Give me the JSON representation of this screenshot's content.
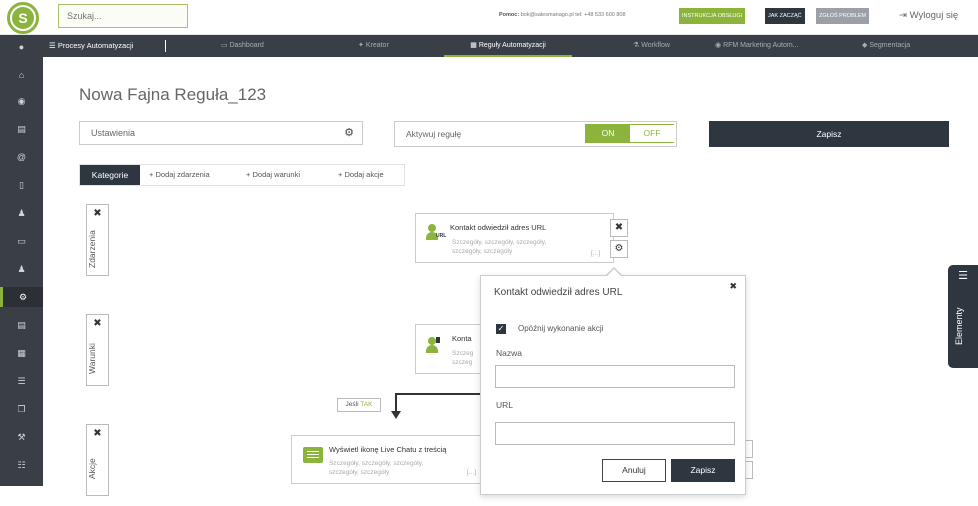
{
  "topbar": {
    "logo_letter": "S",
    "search_placeholder": "Szukaj...",
    "help_label": "Pomoc:",
    "help_contact": "bok@salesmanago.pl tel: +48 533 600 808",
    "btn_instrukcja": "INSTRUKCJA OBSŁUGI",
    "btn_jak_zaczac": "JAK ZACZĄĆ",
    "btn_zglos": "ZGŁOŚ PROBLEM",
    "logout": "Wyloguj się",
    "colors": {
      "instrukcja": "#8cb43c",
      "jak_zaczac": "#2e3640",
      "zglos": "#9aa0a6"
    }
  },
  "navbar": {
    "main": "Procesy Automatyzacji",
    "items": [
      {
        "label": "Dashboard",
        "icon": "monitor-icon"
      },
      {
        "label": "Kreator",
        "icon": "wand-icon"
      },
      {
        "label": "Reguły Automatyzacji",
        "icon": "grid-icon",
        "active": true
      },
      {
        "label": "Workflow",
        "icon": "sitemap-icon"
      },
      {
        "label": "RFM Marketing Autom...",
        "icon": "rfm-icon"
      },
      {
        "label": "Segmentacja",
        "icon": "tag-icon"
      }
    ]
  },
  "sidebar": {
    "icons": [
      "user-circle-icon",
      "home-icon",
      "eye-icon",
      "contact-card-icon",
      "at-icon",
      "mobile-icon",
      "add-user-icon",
      "laptop-icon",
      "users-icon",
      "cogs-icon",
      "chart-icon",
      "calendar-icon",
      "database-icon",
      "copy-icon",
      "wrench-icon",
      "sliders-icon"
    ],
    "active_index": 9
  },
  "page": {
    "title": "Nowa Fajna Reguła_123",
    "settings_label": "Ustawienia",
    "activate_label": "Aktywuj regułę",
    "toggle_on": "ON",
    "toggle_off": "OFF",
    "save_label": "Zapisz"
  },
  "tabs": {
    "kategorie": "Kategorie",
    "dodaj_zdarzenia": "Dodaj zdarzenia",
    "dodaj_warunki": "Dodaj warunki",
    "dodaj_akcje": "Dodaj akcje"
  },
  "sections": {
    "zdarzenia": "Zdarzenia",
    "warunki": "Warunki",
    "akcje": "Akcje"
  },
  "cards": {
    "event": {
      "title": "Kontakt odwiedził adres URL",
      "desc_line1": "Szczegóły, szczegóły, szczegóły,",
      "desc_line2": "szczegóły, szczegóły",
      "more": "[...]",
      "icon_tag": "URL"
    },
    "condition": {
      "title": "Konta",
      "desc_line1": "Szczeg",
      "desc_line2": "szczeg"
    },
    "action": {
      "title": "Wyświetl ikonę Live Chatu z treścią",
      "desc_line1": "Szczegóły, szczegóły, szczegóły,",
      "desc_line2": "szczegóły, szczegóły",
      "more": "[...]"
    },
    "yes_tag_prefix": "Jeśli",
    "yes_tag_value": "TAK"
  },
  "popup": {
    "title": "Kontakt odwiedził adres URL",
    "checkbox_label": "Opóźnij wykonanie akcji",
    "field_name_label": "Nazwa",
    "field_name_value": "",
    "field_url_label": "URL",
    "field_url_value": "",
    "cancel": "Anuluj",
    "save": "Zapisz"
  },
  "elements_panel": {
    "label": "Elementy"
  }
}
